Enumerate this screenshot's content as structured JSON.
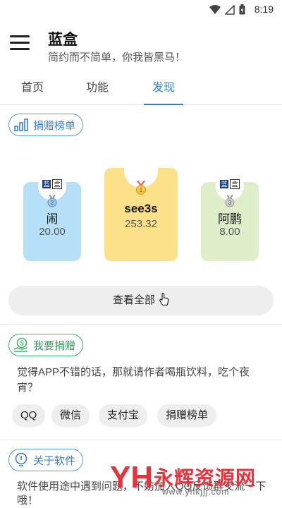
{
  "status": {
    "time": "8:19"
  },
  "header": {
    "title": "蓝盒",
    "subtitle": "简约而不简单，你我皆黑马！"
  },
  "tabs": [
    {
      "label": "首页"
    },
    {
      "label": "功能"
    },
    {
      "label": "发现"
    }
  ],
  "active_tab": "发现",
  "ranking": {
    "chip_label": "捐赠榜单",
    "donors": [
      {
        "rank": 2,
        "name": "闹",
        "amount": "20.00"
      },
      {
        "rank": 1,
        "name": "see3s",
        "amount": "253.32"
      },
      {
        "rank": 3,
        "name": "阿鹏",
        "amount": "8.00"
      }
    ],
    "view_all_label": "查看全部"
  },
  "donate": {
    "chip_label": "我要捐赠",
    "description": "觉得APP不错的话，那就请作者喝瓶饮料，吃个夜宵？",
    "options": [
      "QQ",
      "微信",
      "支付宝",
      "捐赠榜单"
    ]
  },
  "about": {
    "chip_label": "关于软件",
    "description": "软件使用途中遇到问题，不妨加入QQ反馈群交流一下哦！"
  },
  "watermark": {
    "title": "永辉资源网",
    "url": "www.yhkjjj.com"
  },
  "colors": {
    "accent": "#2f7fd6",
    "green": "#3fb46e",
    "card_blue": "#b5e0f8",
    "card_gold": "#fde08a",
    "card_green": "#ddeec9"
  }
}
